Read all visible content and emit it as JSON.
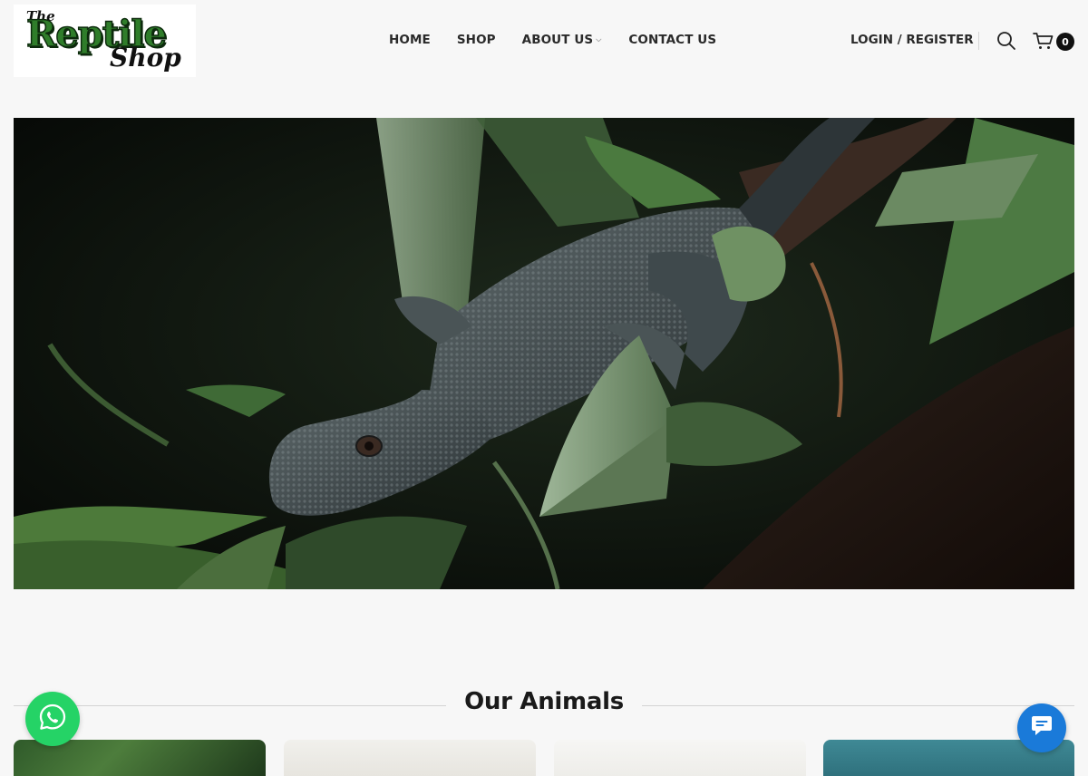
{
  "logo": {
    "line1": "The",
    "line2": "Reptile",
    "line3": "Shop"
  },
  "nav": {
    "items": [
      {
        "label": "HOME"
      },
      {
        "label": "SHOP"
      },
      {
        "label": "ABOUT US",
        "has_dropdown": true
      },
      {
        "label": "CONTACT US"
      }
    ]
  },
  "header": {
    "login_label": "LOGIN / REGISTER",
    "search_icon": "search-icon",
    "cart_icon": "cart-icon",
    "cart_count": "0"
  },
  "hero": {
    "image": "monitor lizard on leaves",
    "icon": "hero-image"
  },
  "section": {
    "title": "Our Animals"
  },
  "floating": {
    "whatsapp_icon": "whatsapp-icon",
    "chat_icon": "chat-icon"
  },
  "colors": {
    "whatsapp": "#25d366",
    "chat": "#1a7ad9",
    "logo_green": "#2f7d2a",
    "text": "#2a2a2a"
  }
}
